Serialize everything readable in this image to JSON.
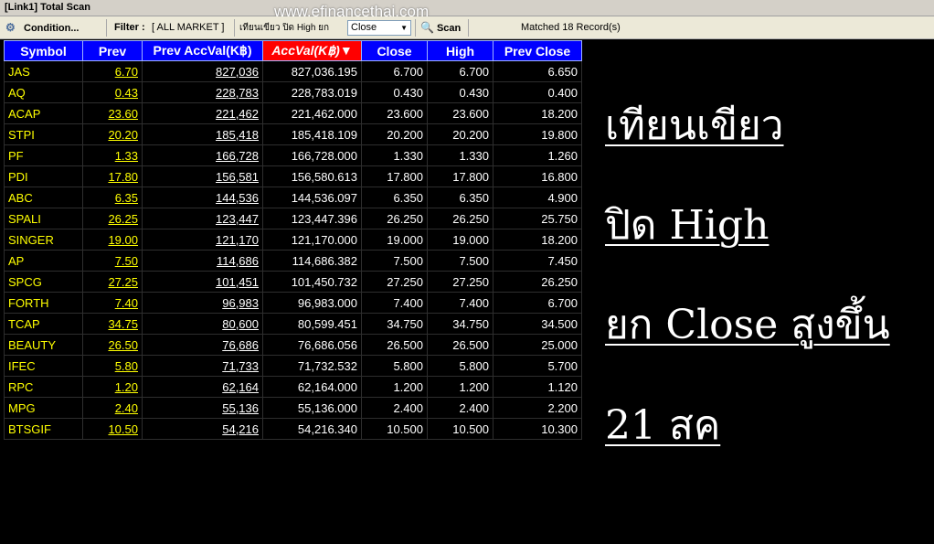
{
  "window": {
    "title": "[Link1] Total Scan",
    "watermark": "www.efinancethai.com"
  },
  "toolbar": {
    "condition_label": "Condition...",
    "filter_label": "Filter :",
    "filter_value": "[ ALL MARKET ]",
    "condition_text": "เทียนเขียว ปิด High ยก",
    "close_select_value": "Close",
    "scan_label": "Scan",
    "matched_text": "Matched 18 Record(s)"
  },
  "table": {
    "headers": [
      "Symbol",
      "Prev",
      "Prev AccVal(K฿)",
      "AccVal(K฿)▼",
      "Close",
      "High",
      "Prev Close"
    ],
    "rows": [
      [
        "JAS",
        "6.70",
        "827,036",
        "827,036.195",
        "6.700",
        "6.700",
        "6.650"
      ],
      [
        "AQ",
        "0.43",
        "228,783",
        "228,783.019",
        "0.430",
        "0.430",
        "0.400"
      ],
      [
        "ACAP",
        "23.60",
        "221,462",
        "221,462.000",
        "23.600",
        "23.600",
        "18.200"
      ],
      [
        "STPI",
        "20.20",
        "185,418",
        "185,418.109",
        "20.200",
        "20.200",
        "19.800"
      ],
      [
        "PF",
        "1.33",
        "166,728",
        "166,728.000",
        "1.330",
        "1.330",
        "1.260"
      ],
      [
        "PDI",
        "17.80",
        "156,581",
        "156,580.613",
        "17.800",
        "17.800",
        "16.800"
      ],
      [
        "ABC",
        "6.35",
        "144,536",
        "144,536.097",
        "6.350",
        "6.350",
        "4.900"
      ],
      [
        "SPALI",
        "26.25",
        "123,447",
        "123,447.396",
        "26.250",
        "26.250",
        "25.750"
      ],
      [
        "SINGER",
        "19.00",
        "121,170",
        "121,170.000",
        "19.000",
        "19.000",
        "18.200"
      ],
      [
        "AP",
        "7.50",
        "114,686",
        "114,686.382",
        "7.500",
        "7.500",
        "7.450"
      ],
      [
        "SPCG",
        "27.25",
        "101,451",
        "101,450.732",
        "27.250",
        "27.250",
        "26.250"
      ],
      [
        "FORTH",
        "7.40",
        "96,983",
        "96,983.000",
        "7.400",
        "7.400",
        "6.700"
      ],
      [
        "TCAP",
        "34.75",
        "80,600",
        "80,599.451",
        "34.750",
        "34.750",
        "34.500"
      ],
      [
        "BEAUTY",
        "26.50",
        "76,686",
        "76,686.056",
        "26.500",
        "26.500",
        "25.000"
      ],
      [
        "IFEC",
        "5.80",
        "71,733",
        "71,732.532",
        "5.800",
        "5.800",
        "5.700"
      ],
      [
        "RPC",
        "1.20",
        "62,164",
        "62,164.000",
        "1.200",
        "1.200",
        "1.120"
      ],
      [
        "MPG",
        "2.40",
        "55,136",
        "55,136.000",
        "2.400",
        "2.400",
        "2.200"
      ],
      [
        "BTSGIF",
        "10.50",
        "54,216",
        "54,216.340",
        "10.500",
        "10.500",
        "10.300"
      ]
    ]
  },
  "annotation": {
    "line1": "เทียนเขียว",
    "line2": "ปิด High",
    "line3": "ยก Close สูงขึ้น",
    "line4": "21 สค"
  },
  "colors": {
    "header_bg": "#0000ff",
    "active_header_bg": "#ff0000",
    "symbol_text": "#ffff00",
    "background": "#000000"
  }
}
